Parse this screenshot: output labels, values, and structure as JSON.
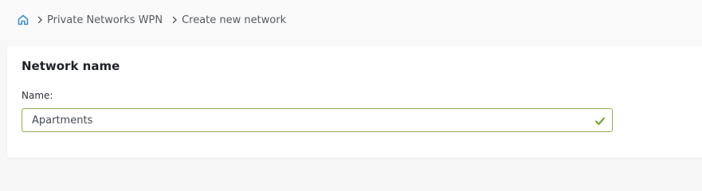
{
  "breadcrumb": {
    "home_icon": "home-icon",
    "items": [
      "Private Networks WPN",
      "Create new network"
    ]
  },
  "card": {
    "title": "Network name",
    "name_label": "Name:",
    "name_value": "Apartments",
    "valid_icon": "check-icon"
  },
  "colors": {
    "accent_blue": "#3d8fd6",
    "valid_green": "#79a33a",
    "input_border": "#8fb04a"
  }
}
